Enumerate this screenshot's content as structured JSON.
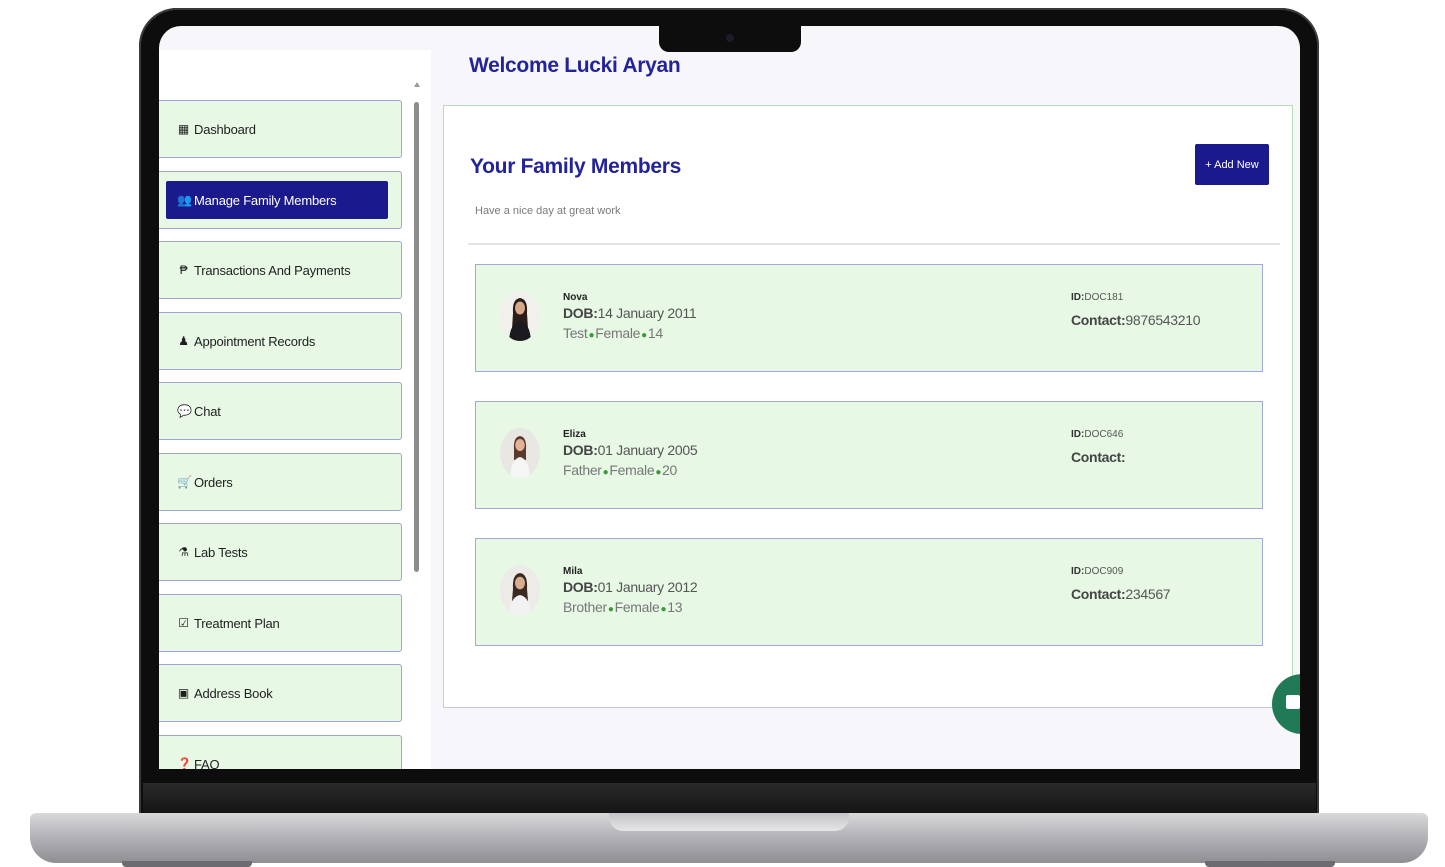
{
  "header": {
    "welcome": "Welcome Lucki Aryan"
  },
  "sidebar": {
    "items": [
      {
        "label": "Dashboard",
        "icon": "dashboard-icon",
        "glyph": "▦"
      },
      {
        "label": "Manage Family Members",
        "icon": "users-icon",
        "glyph": "👥",
        "active": true
      },
      {
        "label": "Transactions And Payments",
        "icon": "paypal-icon",
        "glyph": "₱"
      },
      {
        "label": "Appointment Records",
        "icon": "user-md-icon",
        "glyph": "♟"
      },
      {
        "label": "Chat",
        "icon": "comments-icon",
        "glyph": "💬"
      },
      {
        "label": "Orders",
        "icon": "cart-icon",
        "glyph": "🛒"
      },
      {
        "label": "Lab Tests",
        "icon": "flask-icon",
        "glyph": "⚗"
      },
      {
        "label": "Treatment Plan",
        "icon": "check-square-icon",
        "glyph": "☑"
      },
      {
        "label": "Address Book",
        "icon": "address-book-icon",
        "glyph": "▣"
      },
      {
        "label": "FAQ",
        "icon": "question-circle-icon",
        "glyph": "❓"
      }
    ]
  },
  "panel": {
    "title": "Your Family Members",
    "subtitle": "Have a nice day at great work",
    "add_button": "+ Add New"
  },
  "members": [
    {
      "name": "Nova",
      "dob_label": "DOB:",
      "dob": "14 January 2011",
      "relation": "Test",
      "gender": "Female",
      "age": "14",
      "id_label": "ID:",
      "id": "DOC181",
      "contact_label": "Contact:",
      "contact": "9876543210"
    },
    {
      "name": "Eliza",
      "dob_label": "DOB:",
      "dob": "01 January 2005",
      "relation": "Father",
      "gender": "Female",
      "age": "20",
      "id_label": "ID:",
      "id": "DOC646",
      "contact_label": "Contact:",
      "contact": ""
    },
    {
      "name": "Mila",
      "dob_label": "DOB:",
      "dob": "01 January 2012",
      "relation": "Brother",
      "gender": "Female",
      "age": "13",
      "id_label": "ID:",
      "id": "DOC909",
      "contact_label": "Contact:",
      "contact": "234567"
    }
  ],
  "colors": {
    "accent": "#1a1a8c",
    "card_bg": "#e7f9e5",
    "title": "#23239a"
  }
}
